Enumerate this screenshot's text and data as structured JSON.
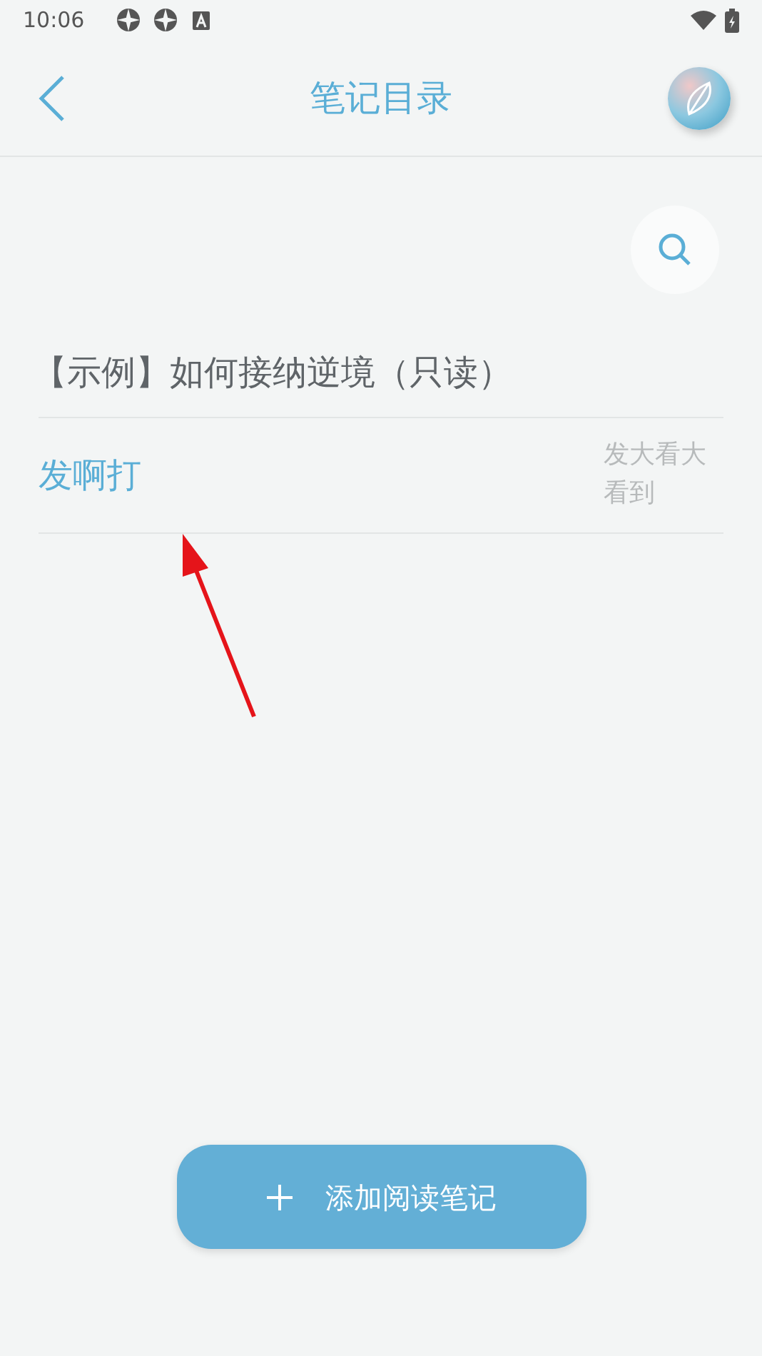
{
  "status_bar": {
    "time": "10:06"
  },
  "header": {
    "title": "笔记目录"
  },
  "book": {
    "title": "【示例】如何接纳逆境（只读）"
  },
  "notes": [
    {
      "title": "发啊打",
      "excerpt": "发大看大看到"
    }
  ],
  "add_button": {
    "label": "添加阅读笔记"
  }
}
